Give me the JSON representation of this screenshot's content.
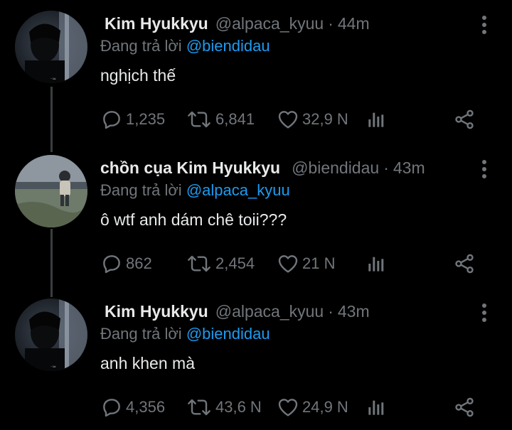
{
  "tweets": [
    {
      "display_name": "Kim Hyukkyu",
      "handle": "@alpaca_kyuu",
      "time": "44m",
      "replying_prefix": "Đang trả lời ",
      "replying_to": "@biendidau",
      "text": "nghịch thế",
      "replies": "1,235",
      "retweets": "6,841",
      "likes": "32,9 N"
    },
    {
      "display_name": "chồn cụa Kim Hyukkyu",
      "handle": "@biendidau",
      "time": "43m",
      "replying_prefix": "Đang trả lời ",
      "replying_to": "@alpaca_kyuu",
      "text": "ô wtf anh dám chê toii???",
      "replies": "862",
      "retweets": "2,454",
      "likes": "21 N"
    },
    {
      "display_name": "Kim Hyukkyu",
      "handle": "@alpaca_kyuu",
      "time": "43m",
      "replying_prefix": "Đang trả lời ",
      "replying_to": "@biendidau",
      "text": "anh khen mà",
      "replies": "4,356",
      "retweets": "43,6 N",
      "likes": "24,9 N"
    }
  ],
  "separator": "·",
  "colors": {
    "background": "#000000",
    "text": "#e7e9ea",
    "muted": "#71767b",
    "link": "#1d9bf0"
  },
  "icons": {
    "reply": "reply-icon",
    "retweet": "retweet-icon",
    "like": "heart-icon",
    "views": "views-icon",
    "share": "share-icon",
    "more": "more-vertical-icon"
  }
}
